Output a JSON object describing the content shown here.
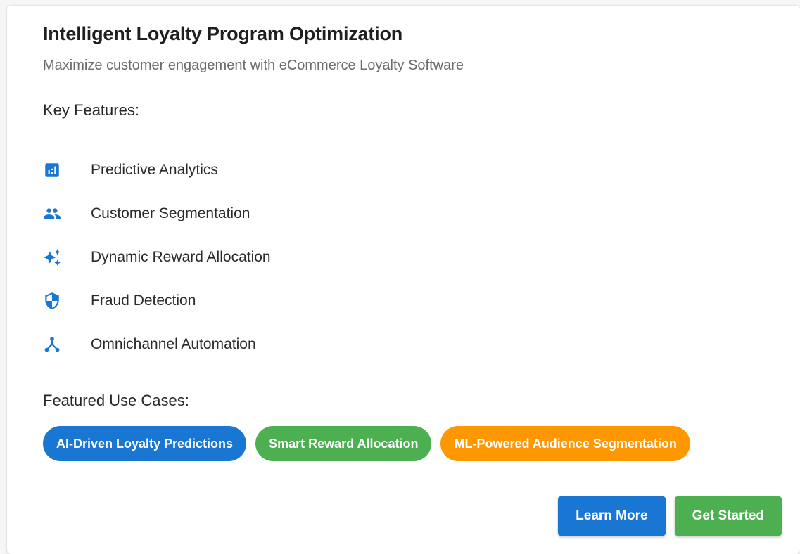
{
  "card": {
    "title": "Intelligent Loyalty Program Optimization",
    "subtitle": "Maximize customer engagement with eCommerce Loyalty Software"
  },
  "features": {
    "heading": "Key Features:",
    "items": [
      {
        "label": "Predictive Analytics",
        "icon": "analytics-icon"
      },
      {
        "label": "Customer Segmentation",
        "icon": "people-icon"
      },
      {
        "label": "Dynamic Reward Allocation",
        "icon": "sparkle-icon"
      },
      {
        "label": "Fraud Detection",
        "icon": "shield-icon"
      },
      {
        "label": "Omnichannel Automation",
        "icon": "hub-icon"
      }
    ]
  },
  "use_cases": {
    "heading": "Featured Use Cases:",
    "chips": [
      {
        "label": "AI-Driven Loyalty Predictions",
        "color": "#1976d2"
      },
      {
        "label": "Smart Reward Allocation",
        "color": "#4caf50"
      },
      {
        "label": "ML-Powered Audience Segmentation",
        "color": "#ff9800"
      }
    ]
  },
  "actions": {
    "learn_more": "Learn More",
    "get_started": "Get Started"
  },
  "colors": {
    "icon": "#1976d2",
    "primary": "#1976d2",
    "success": "#4caf50",
    "warning": "#ff9800"
  }
}
